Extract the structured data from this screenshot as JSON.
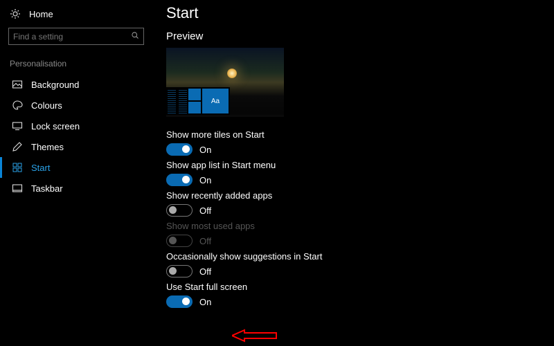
{
  "sidebar": {
    "home_label": "Home",
    "search_placeholder": "Find a setting",
    "section_label": "Personalisation",
    "items": [
      {
        "label": "Background"
      },
      {
        "label": "Colours"
      },
      {
        "label": "Lock screen"
      },
      {
        "label": "Themes"
      },
      {
        "label": "Start"
      },
      {
        "label": "Taskbar"
      }
    ]
  },
  "main": {
    "page_title": "Start",
    "preview_label": "Preview",
    "preview_tile_text": "Aa",
    "settings": [
      {
        "label": "Show more tiles on Start",
        "on": true,
        "state": "On",
        "disabled": false
      },
      {
        "label": "Show app list in Start menu",
        "on": true,
        "state": "On",
        "disabled": false
      },
      {
        "label": "Show recently added apps",
        "on": false,
        "state": "Off",
        "disabled": false
      },
      {
        "label": "Show most used apps",
        "on": false,
        "state": "Off",
        "disabled": true
      },
      {
        "label": "Occasionally show suggestions in Start",
        "on": false,
        "state": "Off",
        "disabled": false
      },
      {
        "label": "Use Start full screen",
        "on": true,
        "state": "On",
        "disabled": false
      }
    ]
  }
}
